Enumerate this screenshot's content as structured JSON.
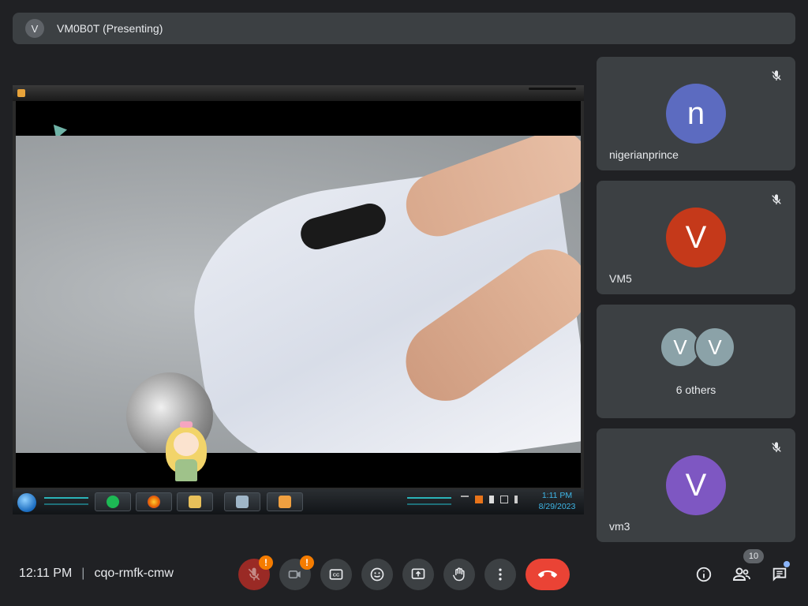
{
  "presenter": {
    "avatar_letter": "V",
    "name": "VM0B0T (Presenting)"
  },
  "shared_screen": {
    "taskbar": {
      "time": "1:11 PM",
      "date": "8/29/2023",
      "apps": [
        "spotify-icon",
        "firefox-icon",
        "explorer-icon",
        "photos-icon",
        "media-player-icon"
      ]
    }
  },
  "participants": [
    {
      "letter": "n",
      "name": "nigerianprince",
      "color": "#5c6bc0",
      "muted": true
    },
    {
      "letter": "V",
      "name": "VM5",
      "color": "#c5391a",
      "muted": true
    },
    {
      "letter": "V",
      "name": "vm3",
      "color": "#7e57c2",
      "muted": true
    }
  ],
  "others": {
    "letters": [
      "V",
      "V"
    ],
    "label": "6 others"
  },
  "footer": {
    "time": "12:11 PM",
    "separator": "|",
    "meeting_code": "cqo-rmfk-cmw",
    "mic_badge": "!",
    "cam_badge": "!",
    "participant_count": "10"
  },
  "colors": {
    "background": "#202124",
    "tile": "#3c4043",
    "end_call": "#ea4335",
    "warning": "#f57c00",
    "notify_dot": "#8ab4f8"
  }
}
